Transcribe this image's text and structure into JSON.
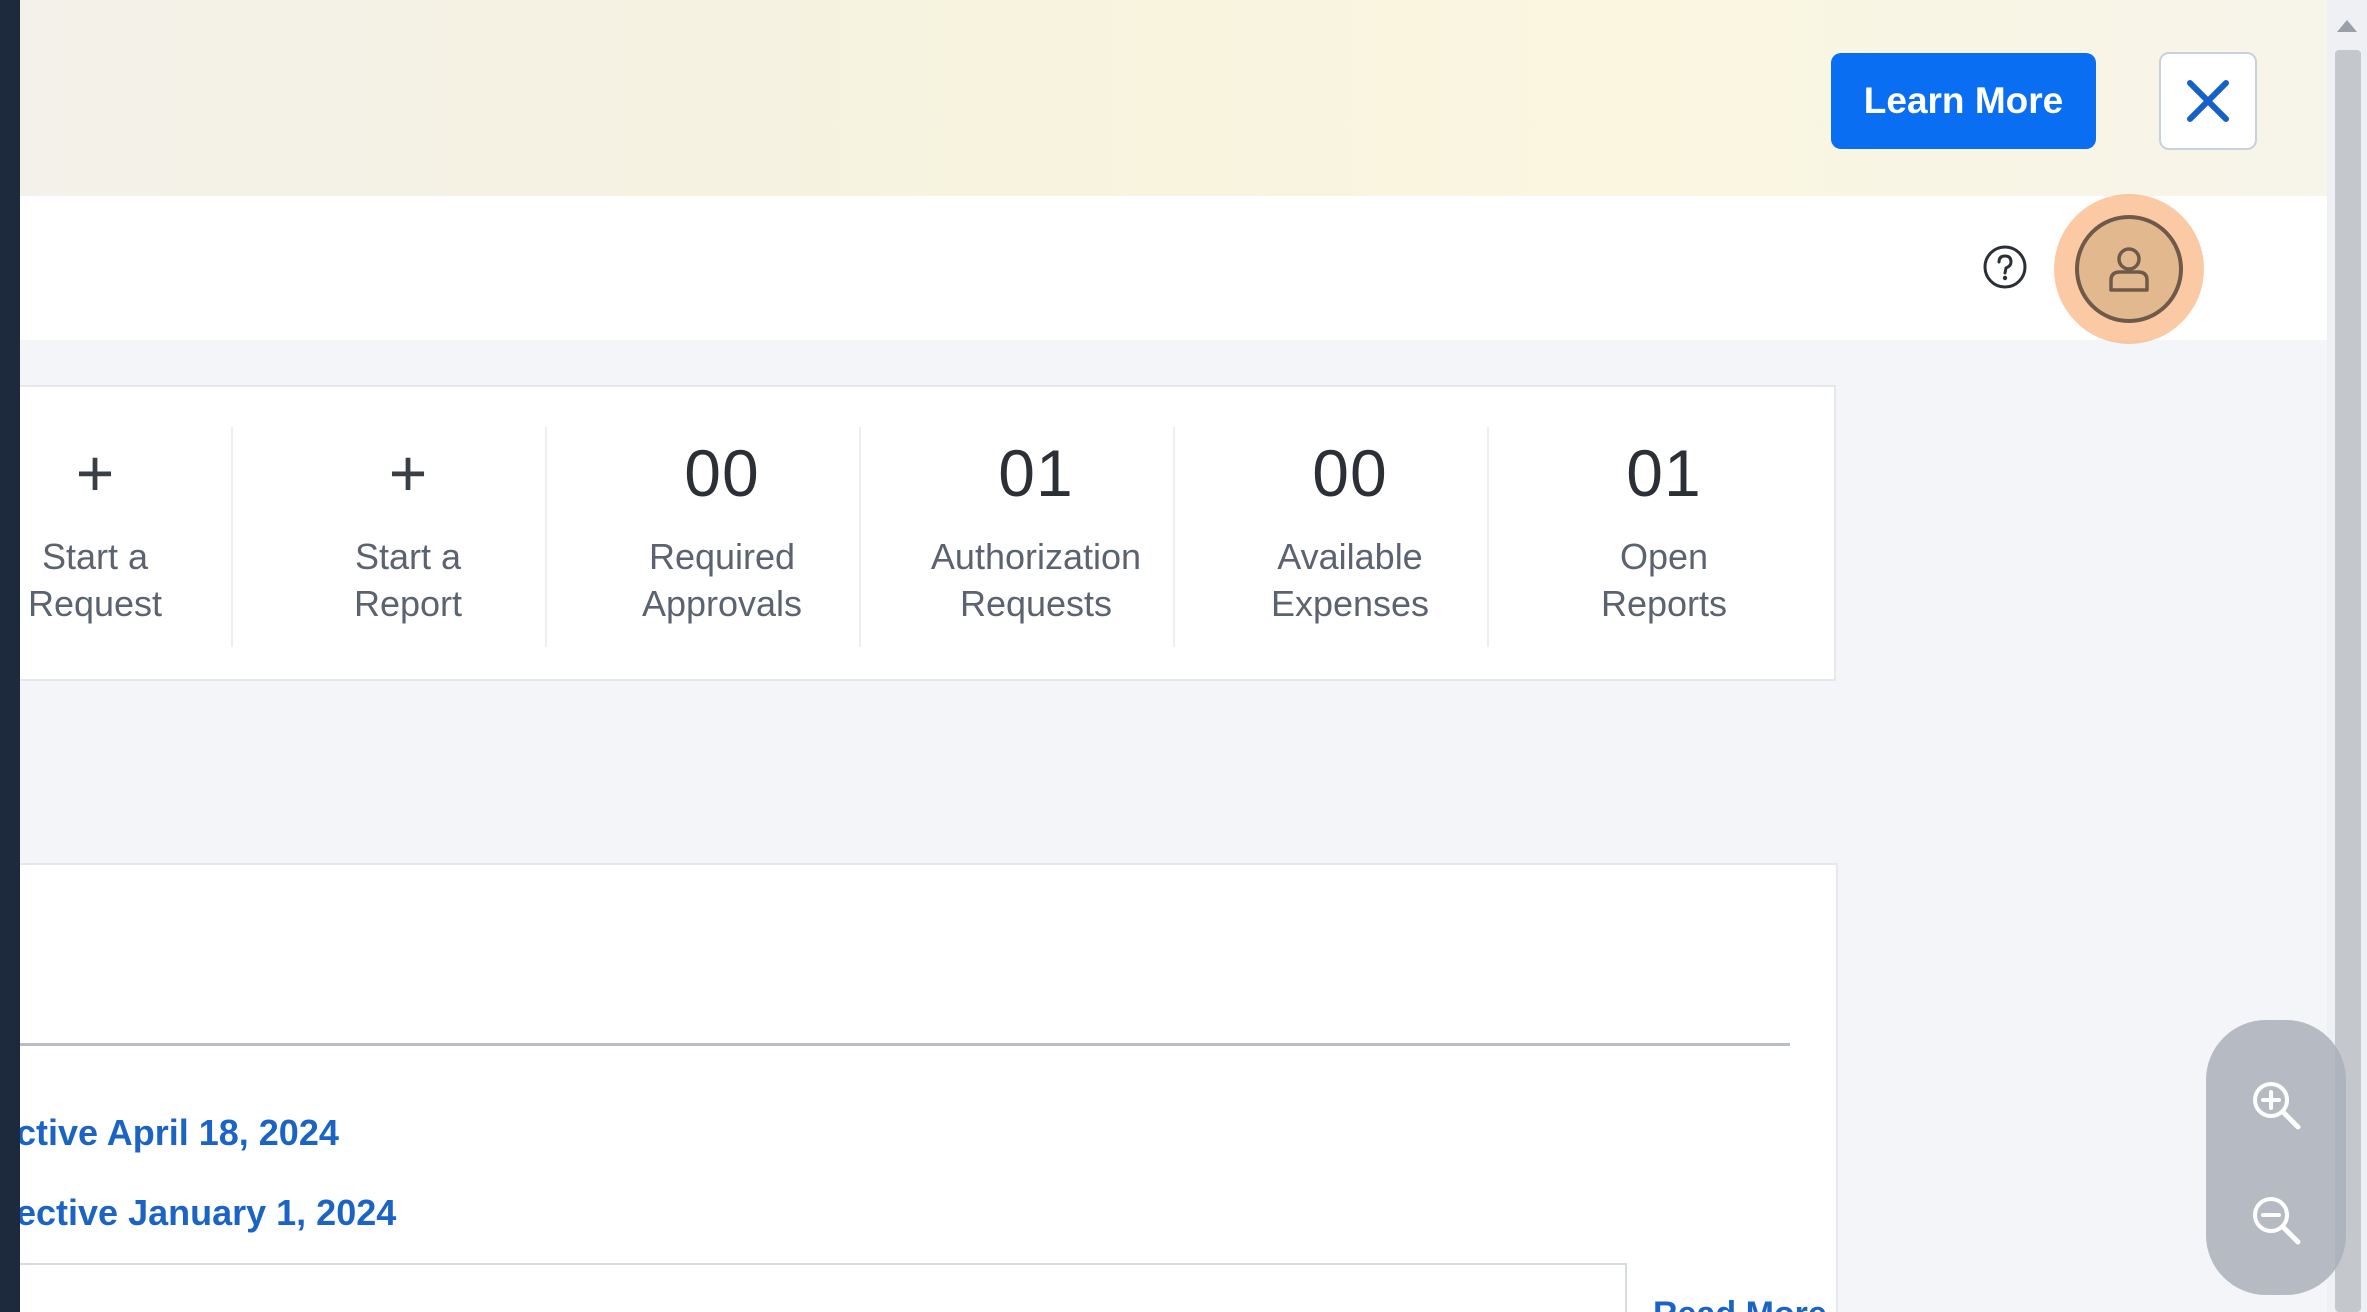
{
  "banner": {
    "learn_more_label": "Learn More"
  },
  "tiles": [
    {
      "icon": "+",
      "label_line1": "Start a",
      "label_line2": "Request"
    },
    {
      "icon": "+",
      "label_line1": "Start a",
      "label_line2": "Report"
    },
    {
      "count": "00",
      "label_line1": "Required",
      "label_line2": "Approvals"
    },
    {
      "count": "01",
      "label_line1": "Authorization",
      "label_line2": "Requests"
    },
    {
      "count": "00",
      "label_line1": "Available",
      "label_line2": "Expenses"
    },
    {
      "count": "01",
      "label_line1": "Open",
      "label_line2": "Reports"
    }
  ],
  "panel": {
    "link1": "ctive April 18, 2024",
    "link2": "ective January 1, 2024",
    "read_more": "Read More"
  },
  "colors": {
    "primary": "#0a6ef2",
    "link": "#1b64c4",
    "avatar_highlight": "#f79c5a"
  },
  "icons": {
    "close": "close-icon",
    "help": "help-icon",
    "profile": "profile-icon",
    "zoom_in": "zoom-in-icon",
    "zoom_out": "zoom-out-icon"
  }
}
